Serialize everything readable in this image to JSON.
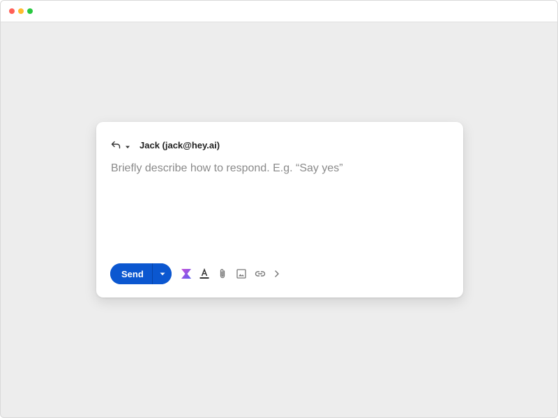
{
  "window": {
    "traffic_lights": {
      "close_color": "#ff5f57",
      "minimize_color": "#febc2e",
      "zoom_color": "#28c840"
    }
  },
  "composer": {
    "reply_icon": "reply-icon",
    "reply_menu_icon": "caret-down-icon",
    "recipient": "Jack (jack@hey.ai)",
    "prompt_placeholder": "Briefly describe how to respond. E.g. “Say yes”",
    "prompt_value": ""
  },
  "toolbar": {
    "send_label": "Send",
    "send_options_icon": "caret-down-icon",
    "accent_color": "#0b57d0",
    "icons": [
      "ai-assist-icon",
      "text-format-icon",
      "paperclip-icon",
      "image-icon",
      "link-icon",
      "chevron-right-icon"
    ]
  }
}
